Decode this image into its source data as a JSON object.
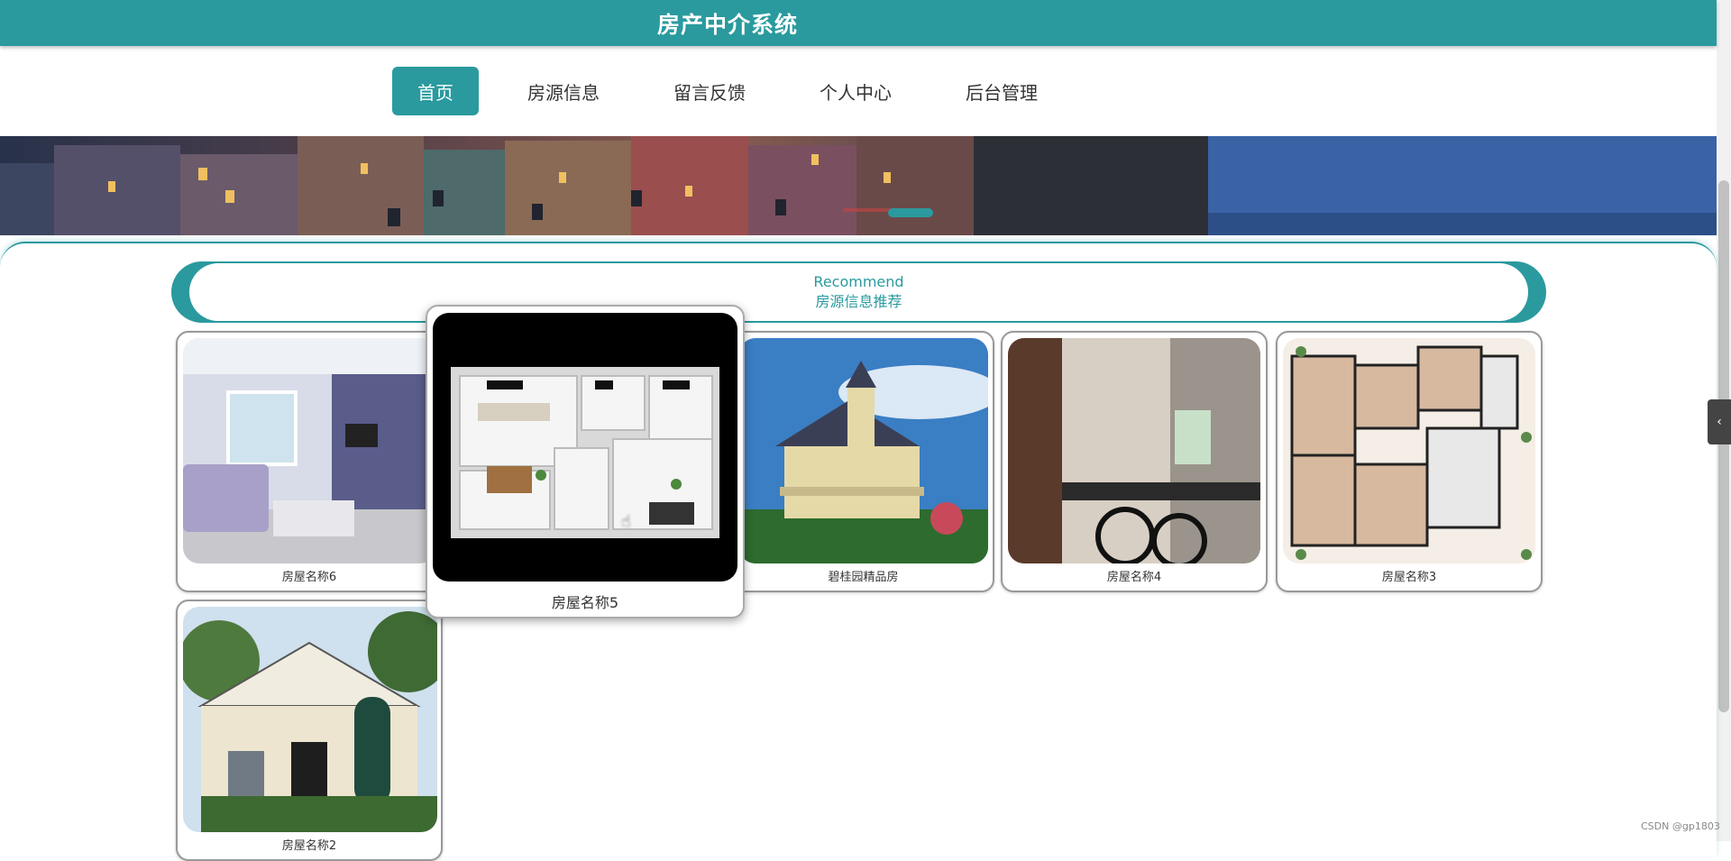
{
  "header": {
    "title": "房产中介系统"
  },
  "nav": {
    "items": [
      {
        "label": "首页",
        "active": true
      },
      {
        "label": "房源信息",
        "active": false
      },
      {
        "label": "留言反馈",
        "active": false
      },
      {
        "label": "个人中心",
        "active": false
      },
      {
        "label": "后台管理",
        "active": false
      }
    ]
  },
  "recommend": {
    "title_en": "Recommend",
    "title_cn": "房源信息推荐"
  },
  "cards": [
    {
      "name": "房屋名称6"
    },
    {
      "name": "房屋名称5"
    },
    {
      "name": "碧桂园精品房"
    },
    {
      "name": "房屋名称4"
    },
    {
      "name": "房屋名称3"
    },
    {
      "name": "房屋名称2"
    }
  ],
  "watermark": "CSDN @gp1803",
  "colors": {
    "primary": "#2a9a9e"
  }
}
